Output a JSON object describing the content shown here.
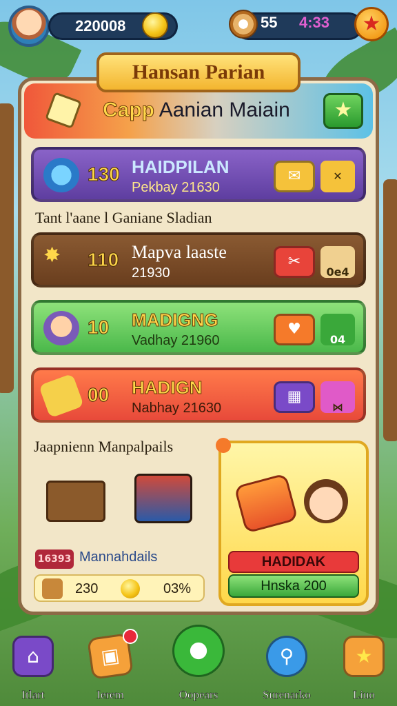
{
  "hud": {
    "coins": "220008",
    "value2": "55",
    "value3": "4:33"
  },
  "banner": {
    "title": "Hansan Parian"
  },
  "hero": {
    "title_a": "Capp",
    "title_b": "Aanian Maiain"
  },
  "rows": [
    {
      "num": "130",
      "title": "HAIDPILAN",
      "subtitle": "Pekbay 21630",
      "side": ""
    },
    {
      "num": "110",
      "title": "Mapva laaste",
      "subtitle": "21930",
      "side": "0e4"
    },
    {
      "num": "10",
      "title": "MADIGNG",
      "subtitle": "Vadhay 21960",
      "side": "04"
    },
    {
      "num": "00",
      "title": "HADIGN",
      "subtitle": "Nabhay 21630",
      "side": ""
    }
  ],
  "section1": "Tant l'aane l Ganiane Sladian",
  "section2": "Jaapnienn Manpalpails",
  "bottom_left": {
    "tag": "16393",
    "label": "Mannahdails",
    "stat_a": "230",
    "stat_b": "03%"
  },
  "card": {
    "red_label": "HADIDAK",
    "green_label": "Hnska 200"
  },
  "nav": [
    {
      "label": "Itlart"
    },
    {
      "label": "Ierem"
    },
    {
      "label": "Oopears"
    },
    {
      "label": "Surenarko"
    },
    {
      "label": "Liuo"
    }
  ]
}
